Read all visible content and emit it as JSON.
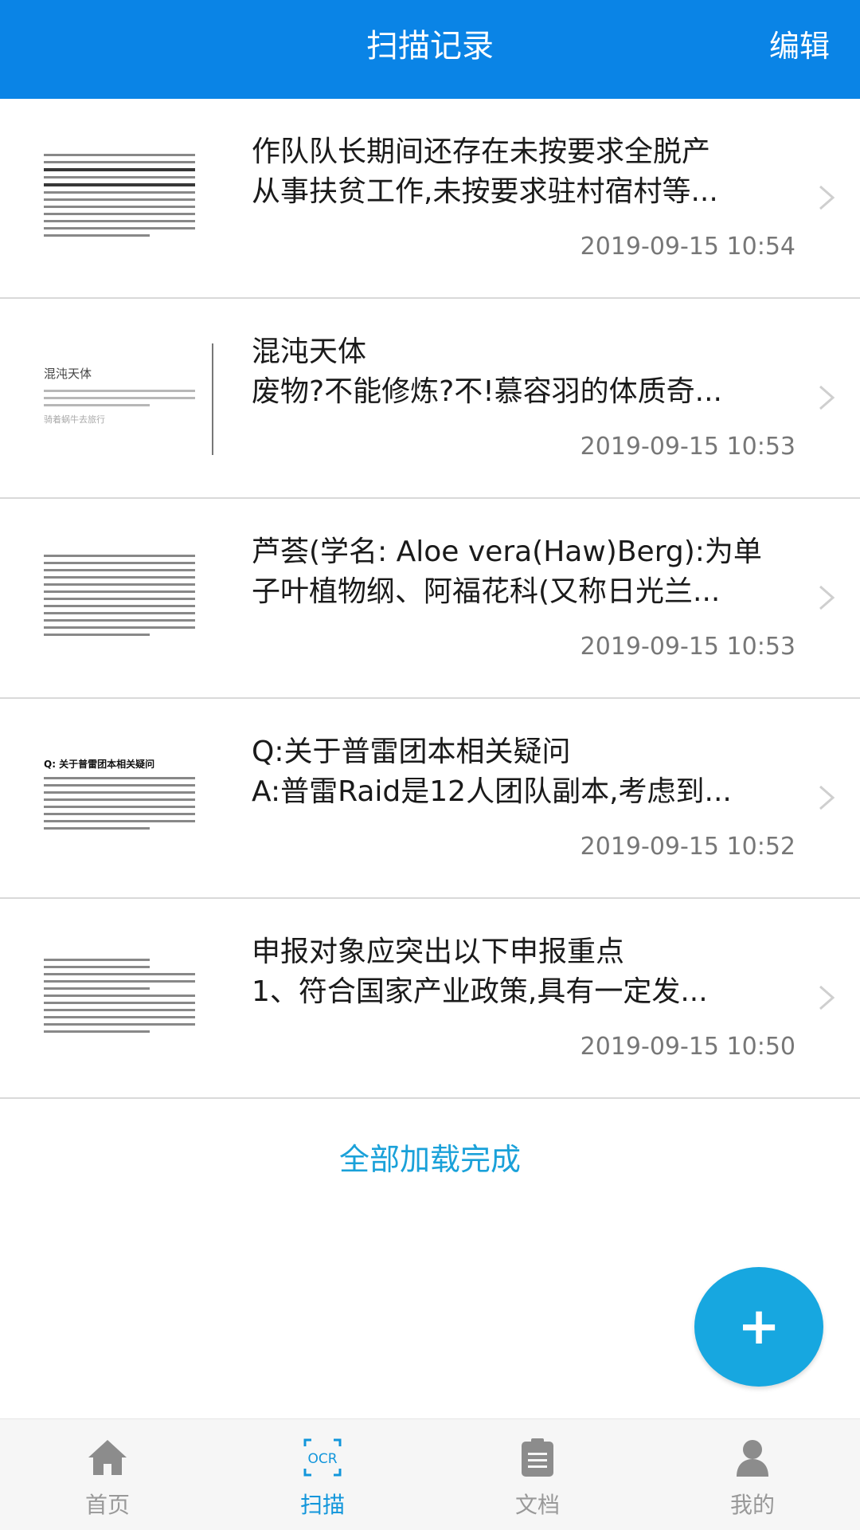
{
  "header": {
    "title": "扫描记录",
    "edit": "编辑"
  },
  "records": [
    {
      "line1": "作队队长期间还存在未按要求全脱产",
      "line2": "从事扶贫工作,未按要求驻村宿村等...",
      "time": "2019-09-15 10:54"
    },
    {
      "line1": "混沌天体",
      "line2": "废物?不能修炼?不!慕容羽的体质奇...",
      "time": "2019-09-15 10:53"
    },
    {
      "line1": "芦荟(学名: Aloe vera(Haw)Berg):为单",
      "line2": "子叶植物纲、阿福花科(又称日光兰...",
      "time": "2019-09-15 10:53"
    },
    {
      "line1": "Q:关于普雷团本相关疑问",
      "line2": "A:普雷Raid是12人团队副本,考虑到...",
      "time": "2019-09-15 10:52"
    },
    {
      "line1": "申报对象应突出以下申报重点",
      "line2": "1、符合国家产业政策,具有一定发...",
      "time": "2019-09-15 10:50"
    }
  ],
  "thumbs": {
    "novel_title": "混沌天体",
    "novel_sub": "骑着蜗牛去旅行",
    "qa_title": "Q: 关于普雷团本相关疑问"
  },
  "footer": {
    "loaded": "全部加载完成"
  },
  "fab": {
    "label": "+"
  },
  "tabs": [
    {
      "label": "首页",
      "icon": "home-icon",
      "active": false
    },
    {
      "label": "扫描",
      "icon": "ocr-icon",
      "active": true
    },
    {
      "label": "文档",
      "icon": "document-icon",
      "active": false
    },
    {
      "label": "我的",
      "icon": "user-icon",
      "active": false
    }
  ],
  "colors": {
    "header": "#0a84e6",
    "accent": "#17a7e0",
    "active_tab": "#1296db"
  }
}
